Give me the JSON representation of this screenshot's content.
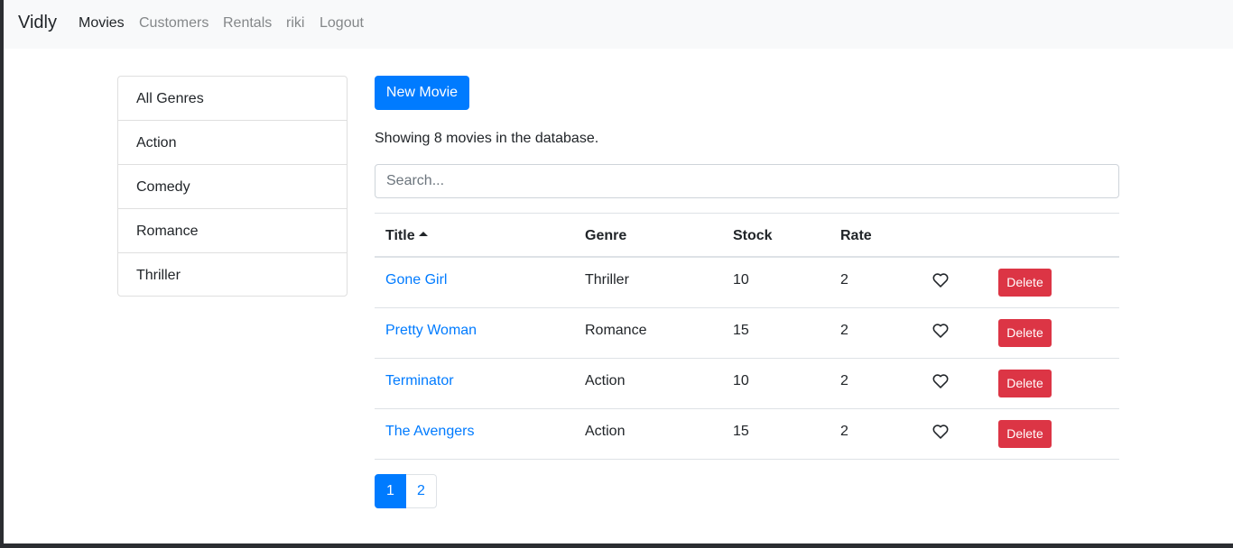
{
  "navbar": {
    "brand": "Vidly",
    "links": [
      "Movies",
      "Customers",
      "Rentals",
      "riki",
      "Logout"
    ],
    "active": "Movies"
  },
  "genres": [
    "All Genres",
    "Action",
    "Comedy",
    "Romance",
    "Thriller"
  ],
  "new_movie_label": "New Movie",
  "count_text": "Showing 8 movies in the database.",
  "search": {
    "placeholder": "Search...",
    "value": ""
  },
  "table": {
    "columns": [
      "Title",
      "Genre",
      "Stock",
      "Rate"
    ],
    "sorted_by": "Title",
    "sort_order": "asc",
    "rows": [
      {
        "title": "Gone Girl",
        "genre": "Thriller",
        "stock": "10",
        "rate": "2"
      },
      {
        "title": "Pretty Woman",
        "genre": "Romance",
        "stock": "15",
        "rate": "2"
      },
      {
        "title": "Terminator",
        "genre": "Action",
        "stock": "10",
        "rate": "2"
      },
      {
        "title": "The Avengers",
        "genre": "Action",
        "stock": "15",
        "rate": "2"
      }
    ],
    "like_icon": "heart-outline-icon",
    "delete_label": "Delete"
  },
  "pagination": {
    "pages": [
      "1",
      "2"
    ],
    "current": "1"
  },
  "colors": {
    "primary": "#007bff",
    "danger": "#dc3545",
    "navbar_bg": "#f8f9fa"
  }
}
